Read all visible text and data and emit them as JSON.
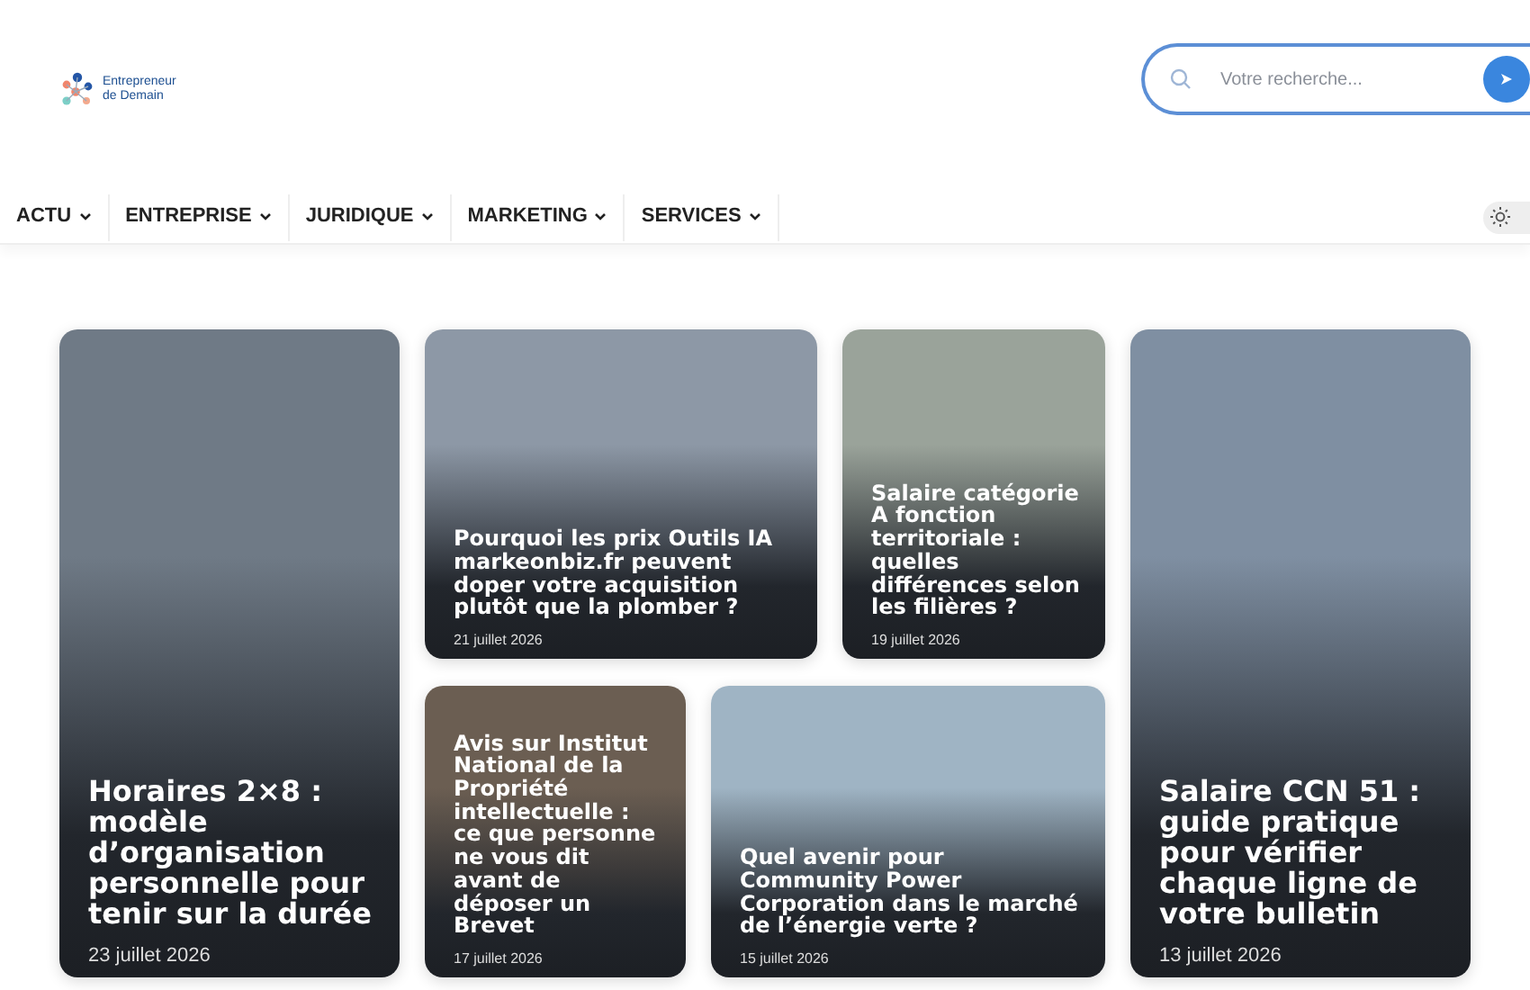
{
  "logo": {
    "lines": [
      "Entrepreneur",
      "de Demain"
    ]
  },
  "search": {
    "placeholder": "Votre recherche..."
  },
  "nav": [
    {
      "label": "ACTU"
    },
    {
      "label": "ENTREPRISE"
    },
    {
      "label": "JURIDIQUE"
    },
    {
      "label": "MARKETING"
    },
    {
      "label": "SERVICES"
    }
  ],
  "articles": [
    {
      "title": "Horaires 2×8 : modèle d’organisation personnelle pour tenir sur la durée",
      "date": "23 juillet 2026"
    },
    {
      "title": "Pourquoi les prix Outils IA markeonbiz.fr peuvent doper votre acquisition plutôt que la plomber ?",
      "date": "21 juillet 2026"
    },
    {
      "title": "Salaire catégorie A fonction territoriale : quelles différences selon les filières ?",
      "date": "19 juillet 2026"
    },
    {
      "title": "Avis sur Institut National de la Propriété intellectuelle : ce que personne ne vous dit avant de déposer un Brevet",
      "date": "17 juillet 2026"
    },
    {
      "title": "Quel avenir pour Community Power Corporation dans le marché de l’énergie verte ?",
      "date": "15 juillet 2026"
    },
    {
      "title": "Salaire CCN 51 : guide pratique pour vérifier chaque ligne de votre bulletin",
      "date": "13 juillet 2026"
    }
  ]
}
